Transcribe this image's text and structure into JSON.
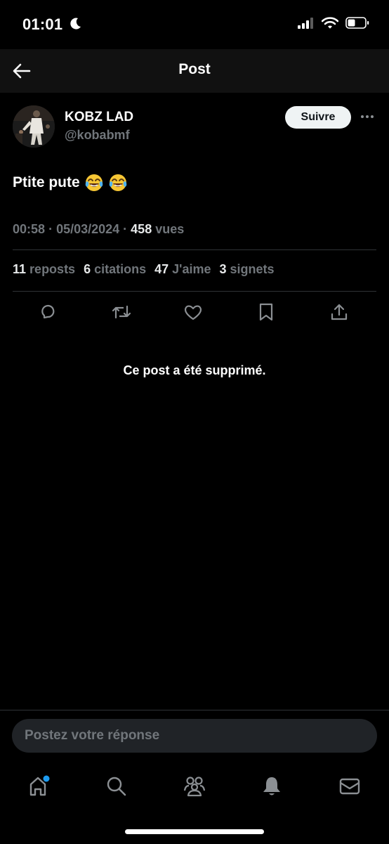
{
  "status": {
    "time": "01:01"
  },
  "header": {
    "title": "Post"
  },
  "post": {
    "author_name": "KOBZ LAD",
    "author_handle": "@kobabmf",
    "follow_label": "Suivre",
    "text": "Ptite pute",
    "emojis": [
      "face-with-tears-of-joy",
      "face-with-tears-of-joy"
    ],
    "time": "00:58",
    "date": "05/03/2024",
    "views_count": "458",
    "views_label": "vues",
    "stats": [
      {
        "num": "11",
        "label": "reposts"
      },
      {
        "num": "6",
        "label": "citations"
      },
      {
        "num": "47",
        "label": "J'aime"
      },
      {
        "num": "3",
        "label": "signets"
      }
    ]
  },
  "deleted_message": "Ce post a été supprimé.",
  "reply": {
    "placeholder": "Postez votre réponse"
  },
  "colors": {
    "background": "#000000",
    "header_bg": "#111111",
    "secondary_text": "#71767b",
    "notification_dot": "#1d9bf0"
  }
}
